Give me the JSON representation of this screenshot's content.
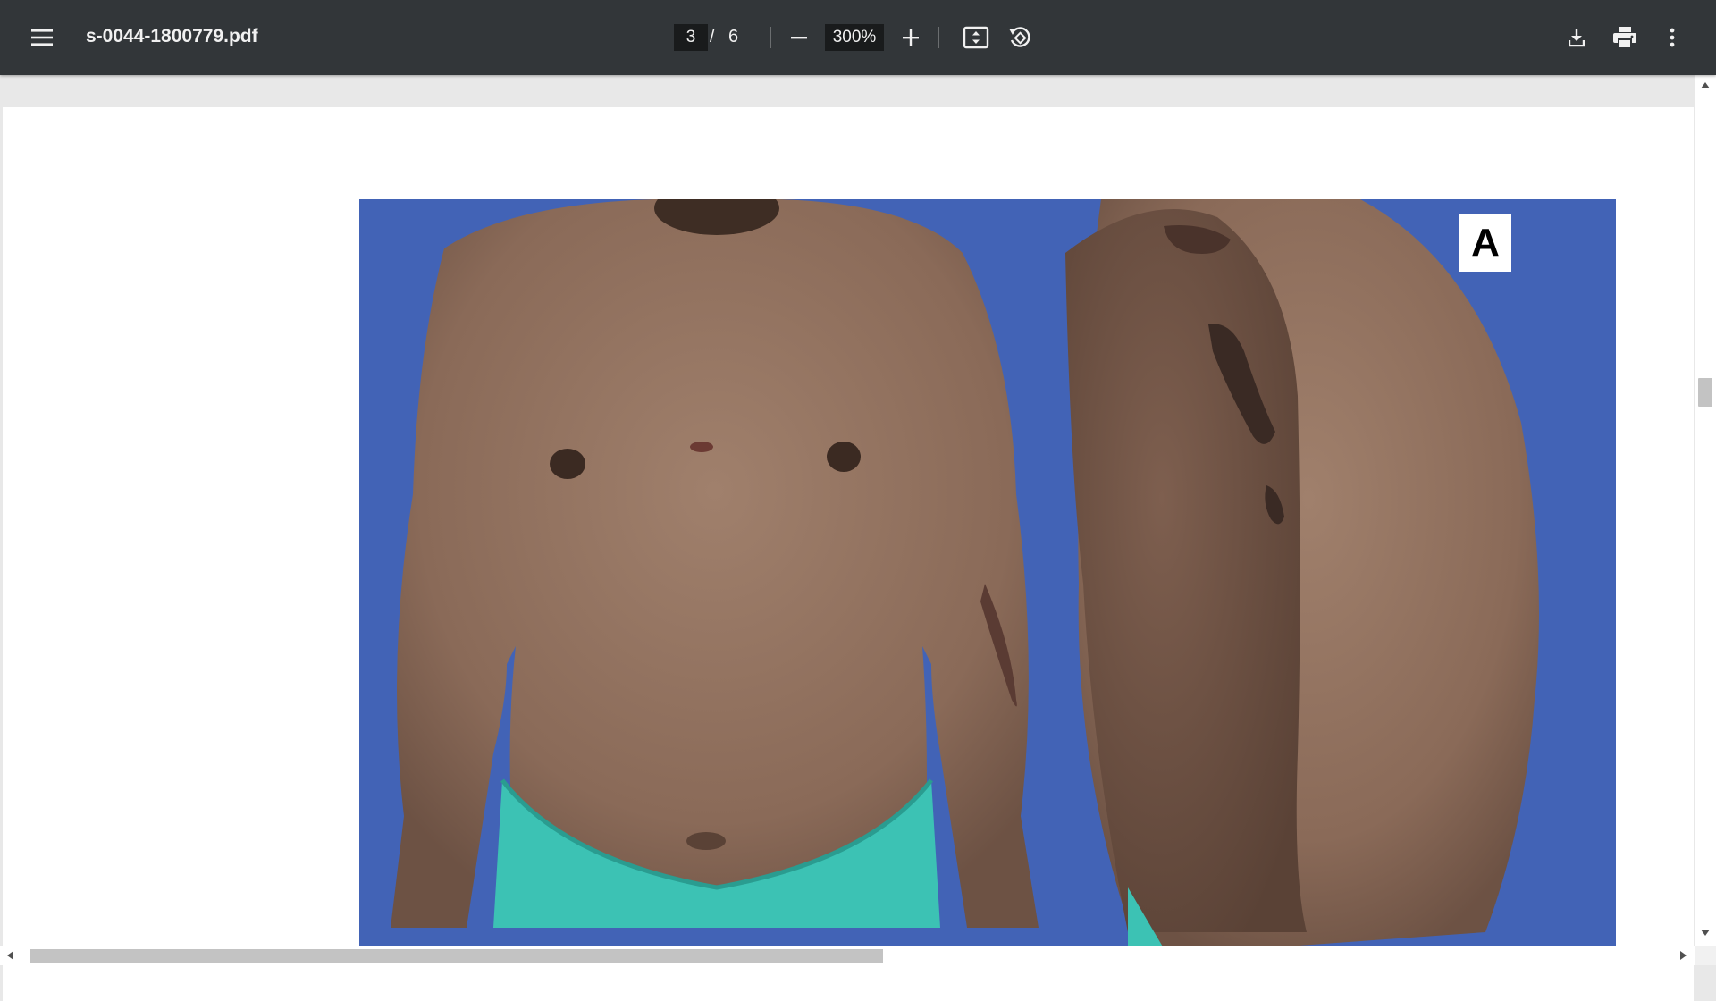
{
  "toolbar": {
    "menu_icon": "hamburger-menu-icon",
    "file_name": "s-0044-1800779.pdf",
    "current_page": "3",
    "page_separator": "/",
    "total_pages": "6",
    "zoom_out_icon": "minus-icon",
    "zoom_level": "300%",
    "zoom_in_icon": "plus-icon",
    "fit_page_icon": "fit-to-page-icon",
    "rotate_icon": "rotate-counterclockwise-icon",
    "download_icon": "download-icon",
    "print_icon": "print-icon",
    "more_icon": "more-vertical-icon"
  },
  "document": {
    "figure_panel_label": "A"
  },
  "colors": {
    "toolbar_bg": "#323639",
    "viewer_bg": "#e8e8e8",
    "photo_backdrop": "#4263b6",
    "skin": "#8a6a58",
    "shorts": "#3cc2b4"
  }
}
